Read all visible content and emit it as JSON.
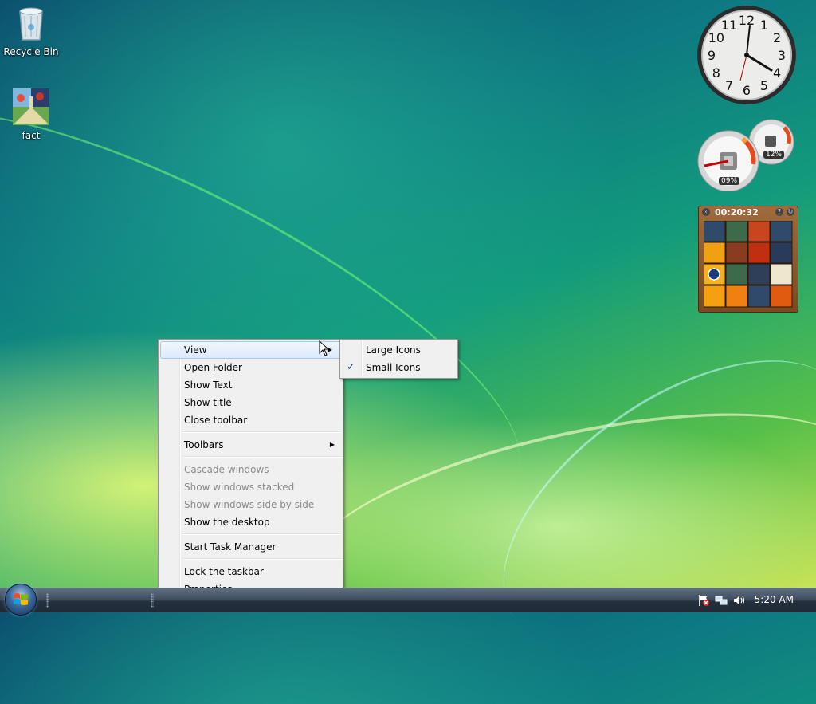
{
  "desktop": {
    "icons": [
      {
        "label": "Recycle Bin",
        "icon": "recycle-bin-icon"
      },
      {
        "label": "fact",
        "icon": "picture-icon"
      }
    ]
  },
  "gadgets": {
    "clock": {
      "numbers": [
        "12",
        "1",
        "2",
        "3",
        "4",
        "5",
        "6",
        "7",
        "8",
        "9",
        "10",
        "11"
      ],
      "time_shown": "5:20"
    },
    "cpu_meter": {
      "cpu_label": "09%",
      "memory_label": "12%"
    },
    "puzzle": {
      "timer": "00:20:32"
    }
  },
  "context_menu": {
    "items": [
      {
        "label": "View",
        "submenu": true,
        "hover": true
      },
      {
        "label": "Open Folder"
      },
      {
        "label": "Show Text"
      },
      {
        "label": "Show title"
      },
      {
        "label": "Close toolbar"
      },
      {
        "separator": true
      },
      {
        "label": "Toolbars",
        "submenu": true
      },
      {
        "separator": true
      },
      {
        "label": "Cascade windows",
        "disabled": true
      },
      {
        "label": "Show windows stacked",
        "disabled": true
      },
      {
        "label": "Show windows side by side",
        "disabled": true
      },
      {
        "label": "Show the desktop"
      },
      {
        "separator": true
      },
      {
        "label": "Start Task Manager"
      },
      {
        "separator": true
      },
      {
        "label": "Lock the taskbar"
      },
      {
        "label": "Properties"
      }
    ]
  },
  "view_submenu": {
    "items": [
      {
        "label": "Large Icons",
        "checked": false
      },
      {
        "label": "Small Icons",
        "checked": true
      }
    ]
  },
  "taskbar": {
    "clock": "5:20 AM",
    "tray_icons": [
      "network-error-flag-icon",
      "network-icon",
      "volume-icon"
    ]
  },
  "colors": {
    "menu_bg": "#f0f0f0",
    "menu_highlight": "#dceafb",
    "check": "#1d3f8a"
  }
}
